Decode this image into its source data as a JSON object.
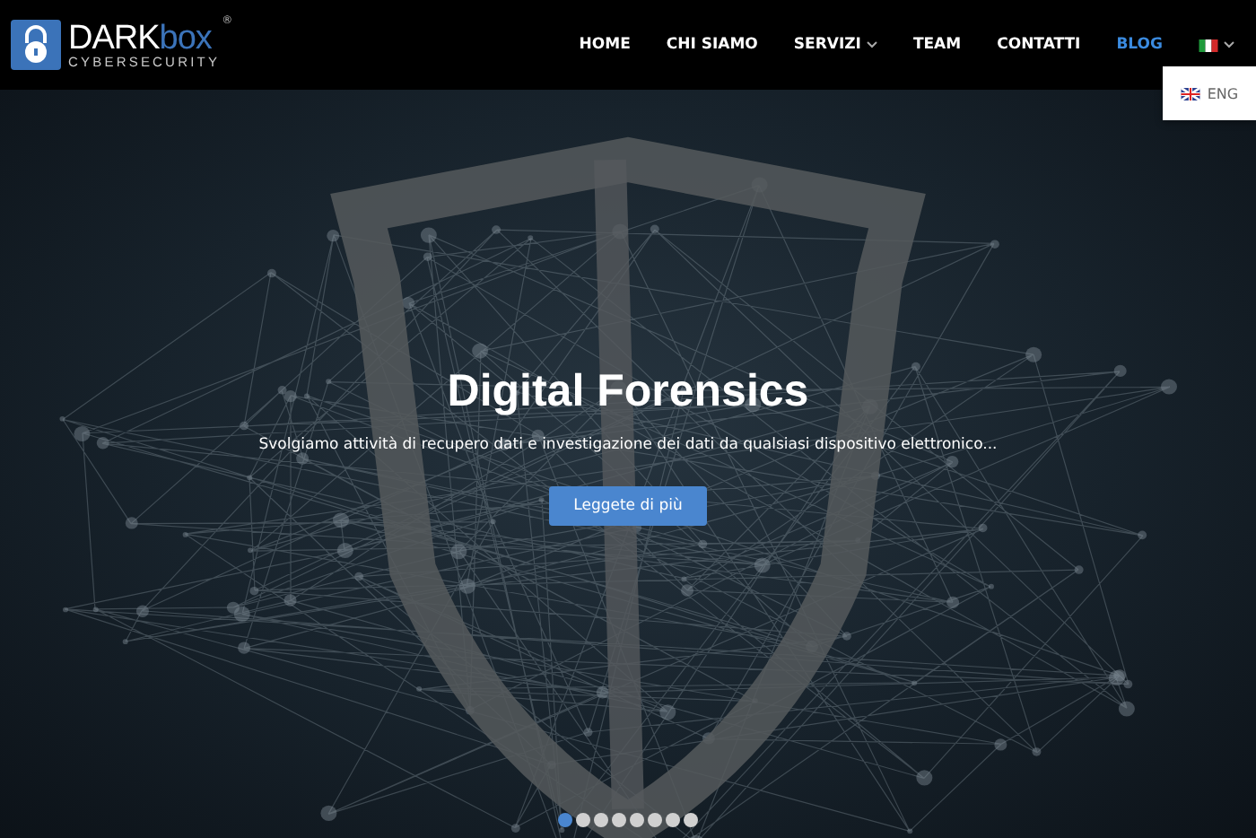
{
  "logo": {
    "word_1": "DARK",
    "word_2": "box",
    "tagline": "CYBERSECURITY",
    "mark": "®"
  },
  "nav": [
    {
      "label": "HOME",
      "selected": false,
      "has_menu": false
    },
    {
      "label": "CHI SIAMO",
      "selected": false,
      "has_menu": false
    },
    {
      "label": "SERVIZI",
      "selected": false,
      "has_menu": true
    },
    {
      "label": "TEAM",
      "selected": false,
      "has_menu": false
    },
    {
      "label": "CONTATTI",
      "selected": false,
      "has_menu": false
    },
    {
      "label": "BLOG",
      "selected": true,
      "has_menu": false
    }
  ],
  "language": {
    "expanded": true,
    "options": [
      {
        "label": "ENG"
      }
    ]
  },
  "hero": {
    "title": "Digital Forensics",
    "subtitle": "Svolgiamo attività di recupero dati e investigazione dei dati da qualsiasi dispositivo elettronico...",
    "button": "Leggete di più"
  },
  "slides": [
    {
      "selected": true
    },
    {
      "selected": false
    },
    {
      "selected": false
    },
    {
      "selected": false
    },
    {
      "selected": false
    },
    {
      "selected": false
    },
    {
      "selected": false
    },
    {
      "selected": false
    }
  ]
}
